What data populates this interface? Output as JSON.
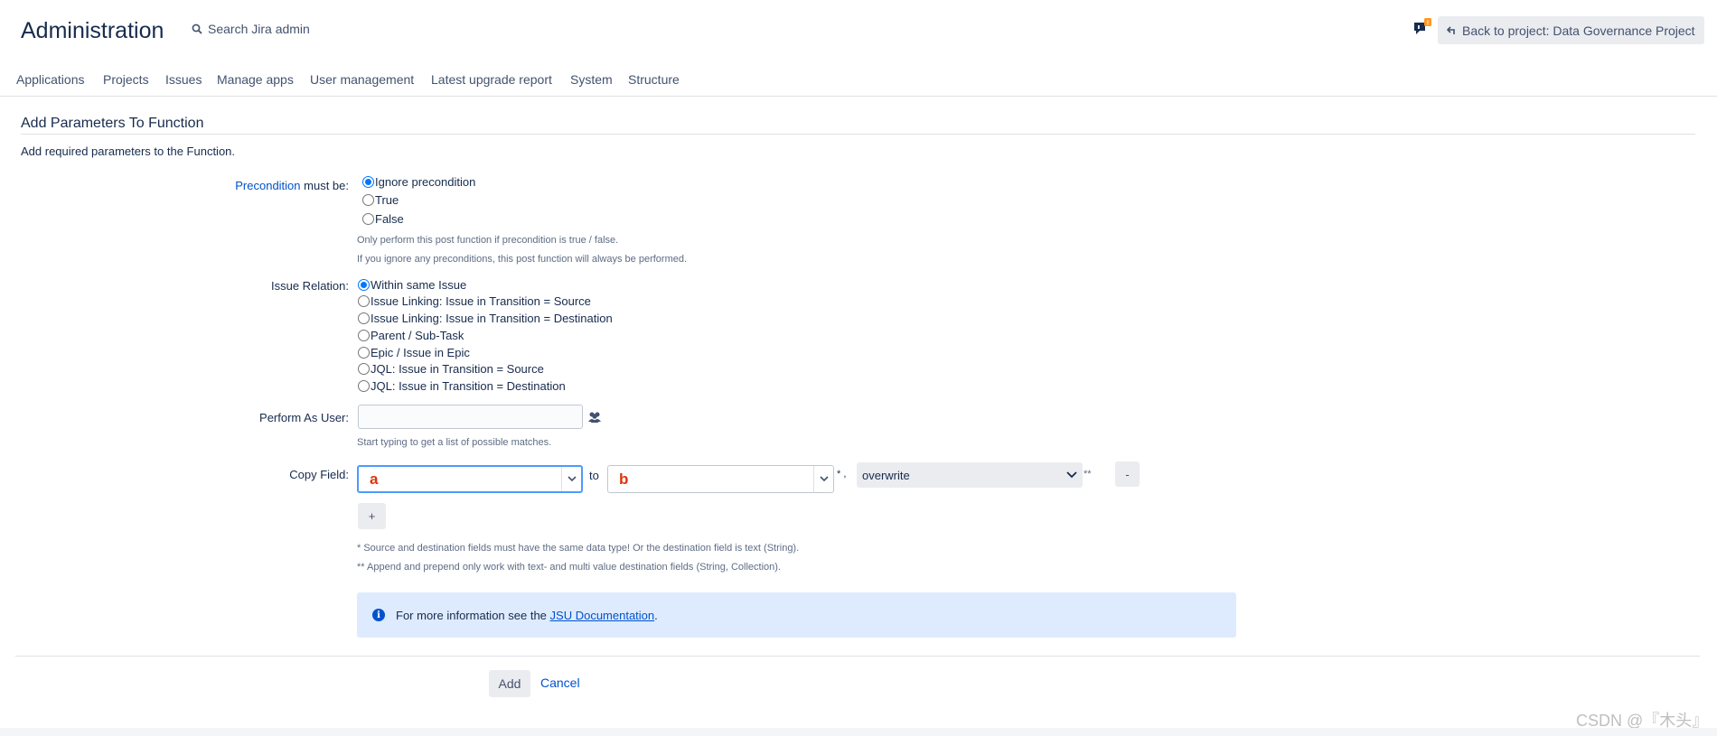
{
  "header": {
    "title": "Administration",
    "search_label": "Search Jira admin",
    "back_button": "Back to project: Data Governance Project",
    "notification_badge": "!"
  },
  "nav": {
    "items": [
      "Applications",
      "Projects",
      "Issues",
      "Manage apps",
      "User management",
      "Latest upgrade report",
      "System",
      "Structure"
    ]
  },
  "form": {
    "title": "Add Parameters To Function",
    "description": "Add required parameters to the Function.",
    "precondition": {
      "link_text": "Precondition",
      "label_suffix": " must be:",
      "options": [
        "Ignore precondition",
        "True",
        "False"
      ],
      "selected": "Ignore precondition",
      "help_1": "Only perform this post function if precondition is true / false.",
      "help_2": "If you ignore any preconditions, this post function will always be performed."
    },
    "issue_relation": {
      "label": "Issue Relation:",
      "options": [
        "Within same Issue",
        "Issue Linking: Issue in Transition = Source",
        "Issue Linking: Issue in Transition = Destination",
        "Parent / Sub-Task",
        "Epic / Issue in Epic",
        "JQL: Issue in Transition = Source",
        "JQL: Issue in Transition = Destination"
      ],
      "selected": "Within same Issue"
    },
    "perform_as_user": {
      "label": "Perform As User:",
      "value": "",
      "help": "Start typing to get a list of possible matches."
    },
    "copy_field": {
      "label": "Copy Field:",
      "source_value": "a",
      "to_text": "to",
      "dest_value": "b",
      "star_text": "* ,",
      "mode_value": "overwrite",
      "double_star": "**",
      "remove_label": "-",
      "add_label": "+",
      "note_1": "* Source and destination fields must have the same data type! Or the destination field is text (String).",
      "note_2": "** Append and prepend only work with text- and multi value destination fields (String, Collection)."
    },
    "info": {
      "prefix": "For more information see the ",
      "link_text": "JSU Documentation",
      "suffix": "."
    },
    "add_button": "Add",
    "cancel_link": "Cancel"
  },
  "watermark": "CSDN @『木头』",
  "colors": {
    "link": "#0052cc",
    "info_bg": "#deebff",
    "annotation_red": "#de350b",
    "focus_border": "#4c9aff",
    "notification": "#ff991f"
  }
}
